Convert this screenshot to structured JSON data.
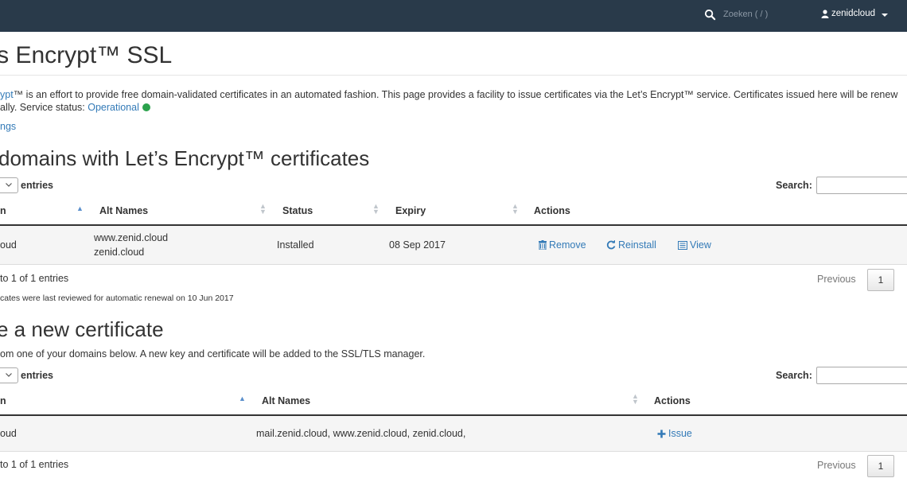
{
  "topbar": {
    "search_placeholder": "Zoeken ( / )",
    "user": "zenidcloud"
  },
  "page": {
    "title": "’s Encrypt™ SSL",
    "intro_link": "ypt",
    "intro_1": "™ is an effort to provide free domain-validated certificates in an automated fashion. This page provides a facility to issue certificates via the Let’s Encrypt™ service. Certificates issued here will be renew",
    "intro_2": "ally. Service status: ",
    "status_link": "Operational",
    "settings_link": "ngs"
  },
  "installed": {
    "title": " domains with Let’s Encrypt™ certificates",
    "entries_label": "entries",
    "search_label": "Search:",
    "columns": [
      "n",
      "Alt Names",
      "Status",
      "Expiry",
      "Actions"
    ],
    "row": {
      "domain": "oud",
      "alt1": "www.zenid.cloud",
      "alt2": "zenid.cloud",
      "status": "Installed",
      "expiry": "08 Sep 2017",
      "remove": "Remove",
      "reinstall": "Reinstall",
      "view": "View"
    },
    "info": " to 1 of 1 entries",
    "previous": "Previous",
    "page": "1",
    "reviewed_note": "cates were last reviewed for automatic renewal on 10 Jun 2017"
  },
  "issue": {
    "title": "e a new certificate",
    "subtitle": "om one of your domains below. A new key and certificate will be added to the SSL/TLS manager.",
    "entries_label": "entries",
    "search_label": "Search:",
    "columns": [
      "n",
      "Alt Names",
      "Actions"
    ],
    "row": {
      "domain": "oud",
      "alt": "mail.zenid.cloud, www.zenid.cloud, zenid.cloud,",
      "issue": "Issue"
    },
    "info": " to 1 of 1 entries",
    "previous": "Previous",
    "page": "1"
  }
}
